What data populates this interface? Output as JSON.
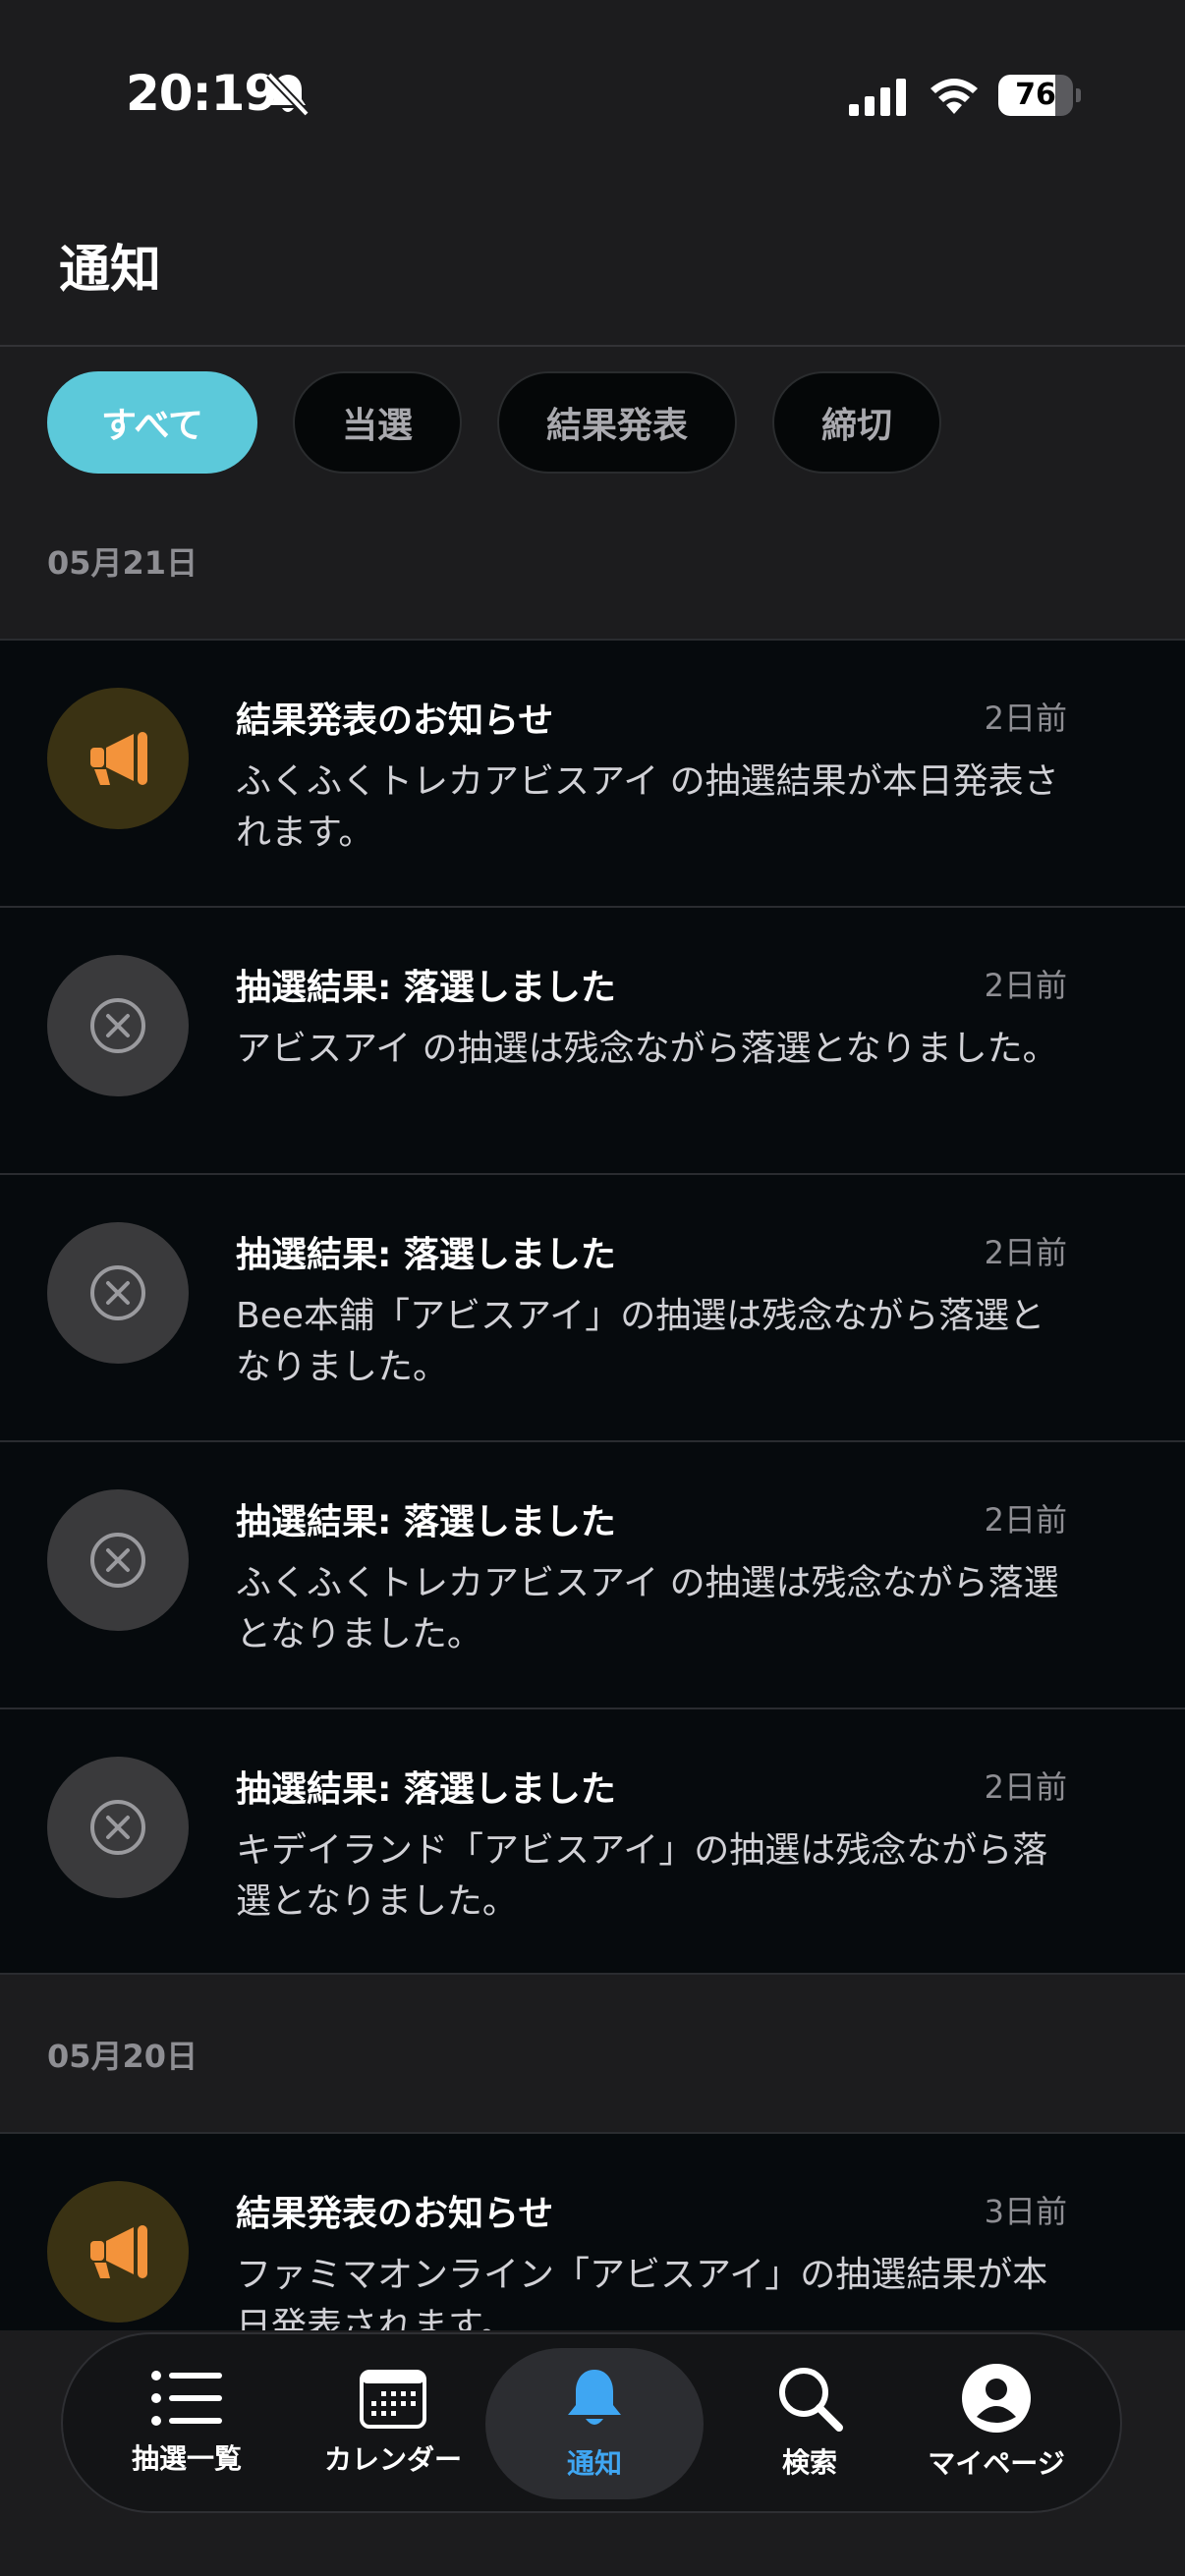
{
  "status_bar": {
    "time": "20:19",
    "battery": "76",
    "battery_level": 0.76
  },
  "header": {
    "title": "通知"
  },
  "filters": [
    {
      "label": "すべて",
      "active": true
    },
    {
      "label": "当選",
      "active": false
    },
    {
      "label": "結果発表",
      "active": false
    },
    {
      "label": "締切",
      "active": false
    }
  ],
  "groups": [
    {
      "date": "05月21日",
      "items": [
        {
          "kind": "announce",
          "icon": "megaphone-icon",
          "title": "結果発表のお知らせ",
          "time": "2日前",
          "body": "ふくふくトレカアビスアイ の抽選結果が本日発表されます。"
        },
        {
          "kind": "lose",
          "icon": "x-circle-icon",
          "title": "抽選結果: 落選しました",
          "time": "2日前",
          "body": "アビスアイ の抽選は残念ながら落選となりました。"
        },
        {
          "kind": "lose",
          "icon": "x-circle-icon",
          "title": "抽選結果: 落選しました",
          "time": "2日前",
          "body": "Bee本舗「アビスアイ」の抽選は残念ながら落選となりました。"
        },
        {
          "kind": "lose",
          "icon": "x-circle-icon",
          "title": "抽選結果: 落選しました",
          "time": "2日前",
          "body": "ふくふくトレカアビスアイ の抽選は残念ながら落選となりました。"
        },
        {
          "kind": "lose",
          "icon": "x-circle-icon",
          "title": "抽選結果: 落選しました",
          "time": "2日前",
          "body": "キデイランド「アビスアイ」の抽選は残念ながら落選となりました。"
        }
      ]
    },
    {
      "date": "05月20日",
      "items": [
        {
          "kind": "announce",
          "icon": "megaphone-icon",
          "title": "結果発表のお知らせ",
          "time": "3日前",
          "body": "ファミマオンライン「アビスアイ」の抽選結果が本日発表されます。"
        }
      ]
    }
  ],
  "tabbar": [
    {
      "label": "抽選一覧",
      "icon": "list-icon",
      "active": false
    },
    {
      "label": "カレンダー",
      "icon": "calendar-icon",
      "active": false
    },
    {
      "label": "通知",
      "icon": "bell-icon",
      "active": true
    },
    {
      "label": "検索",
      "icon": "search-icon",
      "active": false
    },
    {
      "label": "マイページ",
      "icon": "person-icon",
      "active": false
    }
  ],
  "colors": {
    "accent": "#5cc9da",
    "tab_active": "#3fa6f2",
    "megaphone": "#f3933b",
    "background": "#1c1c1e",
    "card": "#060a0d"
  }
}
